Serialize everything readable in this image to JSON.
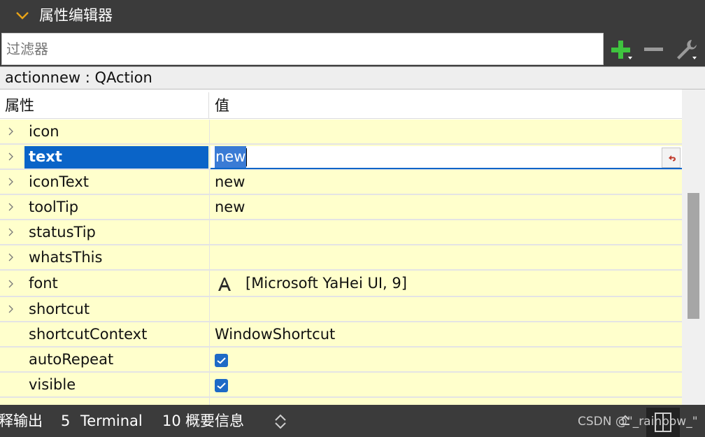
{
  "panel": {
    "title": "属性编辑器",
    "filter_placeholder": "过滤器",
    "object_label": "actionnew : QAction"
  },
  "toolbar": {
    "add_icon": "plus-icon",
    "remove_icon": "minus-icon",
    "config_icon": "wrench-icon"
  },
  "table": {
    "headers": {
      "property": "属性",
      "value": "值"
    },
    "rows": [
      {
        "name": "icon",
        "value": "",
        "expandable": true
      },
      {
        "name": "text",
        "value": "new",
        "expandable": true,
        "selected": true,
        "editing": true
      },
      {
        "name": "iconText",
        "value": "new",
        "expandable": true
      },
      {
        "name": "toolTip",
        "value": "new",
        "expandable": true
      },
      {
        "name": "statusTip",
        "value": "",
        "expandable": true
      },
      {
        "name": "whatsThis",
        "value": "",
        "expandable": true
      },
      {
        "name": "font",
        "value": "[Microsoft YaHei UI, 9]",
        "expandable": true,
        "icon": "font-icon"
      },
      {
        "name": "shortcut",
        "value": "",
        "expandable": true
      },
      {
        "name": "shortcutContext",
        "value": "WindowShortcut",
        "expandable": false
      },
      {
        "name": "autoRepeat",
        "value": "",
        "expandable": false,
        "checked": true
      },
      {
        "name": "visible",
        "value": "",
        "expandable": false,
        "checked": true
      }
    ]
  },
  "status_bar": {
    "item1": "释输出",
    "item2_num": "5",
    "item2_label": "Terminal",
    "item3_num": "10",
    "item3_label": "概要信息",
    "watermark": "CSDN @\"_rainbow_\""
  },
  "colors": {
    "dark_bar": "#3b3b3b",
    "row_bg": "#ffffcc",
    "selection": "#0a64c8",
    "checkbox": "#1e6ac6"
  }
}
